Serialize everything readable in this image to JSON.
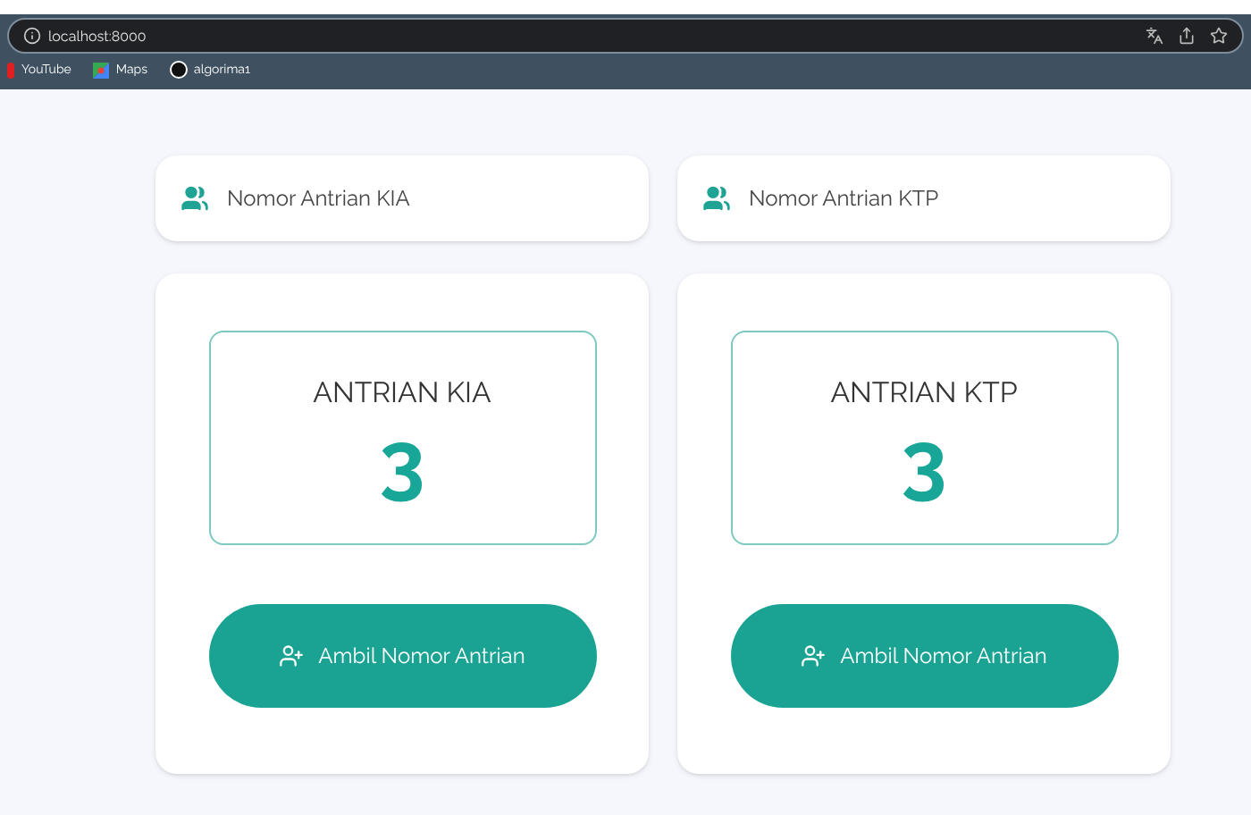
{
  "browser": {
    "url": "localhost:8000",
    "bookmarks": [
      {
        "label": "YouTube",
        "kind": "youtube"
      },
      {
        "label": "Maps",
        "kind": "maps"
      },
      {
        "label": "algorima1",
        "kind": "site"
      }
    ]
  },
  "queues": [
    {
      "header": "Nomor Antrian KIA",
      "title": "ANTRIAN KIA",
      "number": "3",
      "button": "Ambil Nomor Antrian"
    },
    {
      "header": "Nomor Antrian KTP",
      "title": "ANTRIAN KTP",
      "number": "3",
      "button": "Ambil Nomor Antrian"
    }
  ]
}
